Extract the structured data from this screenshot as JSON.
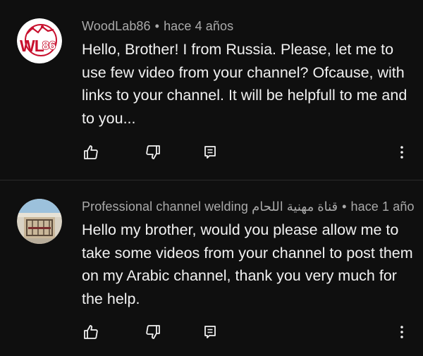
{
  "comments": [
    {
      "author": "WoodLab86",
      "separator": "•",
      "time": "hace 4 años",
      "text": "Hello, Brother! I from Russia. Please, let me to use few video from your channel? Ofcause, with links to your channel. It will be helpfull to me and to you...",
      "avatar_label": "WL",
      "avatar_number": "86",
      "avatar_colors": {
        "bg": "#ffffff",
        "accent": "#c8102e"
      },
      "actions": {
        "like_icon": "thumbs-up-icon",
        "dislike_icon": "thumbs-down-icon",
        "reply_icon": "reply-icon",
        "more_icon": "more-vertical-icon"
      }
    },
    {
      "author": "Professional channel welding قناة مهنية اللحام",
      "separator": "•",
      "time": "hace 1 año",
      "text": "Hello my brother, would you please allow me to take some videos from your channel to post them on my Arabic channel, thank you very much for the help.",
      "avatar_colors": {
        "sky": "#8fb8d8",
        "wall": "#c9b79a",
        "frame": "#5b4a3a"
      },
      "actions": {
        "like_icon": "thumbs-up-icon",
        "dislike_icon": "thumbs-down-icon",
        "reply_icon": "reply-icon",
        "more_icon": "more-vertical-icon"
      }
    }
  ],
  "theme": {
    "background": "#0f0f0f",
    "text": "#f1f1f1",
    "secondary_text": "#aaaaaa",
    "icon": "#f1f1f1"
  }
}
